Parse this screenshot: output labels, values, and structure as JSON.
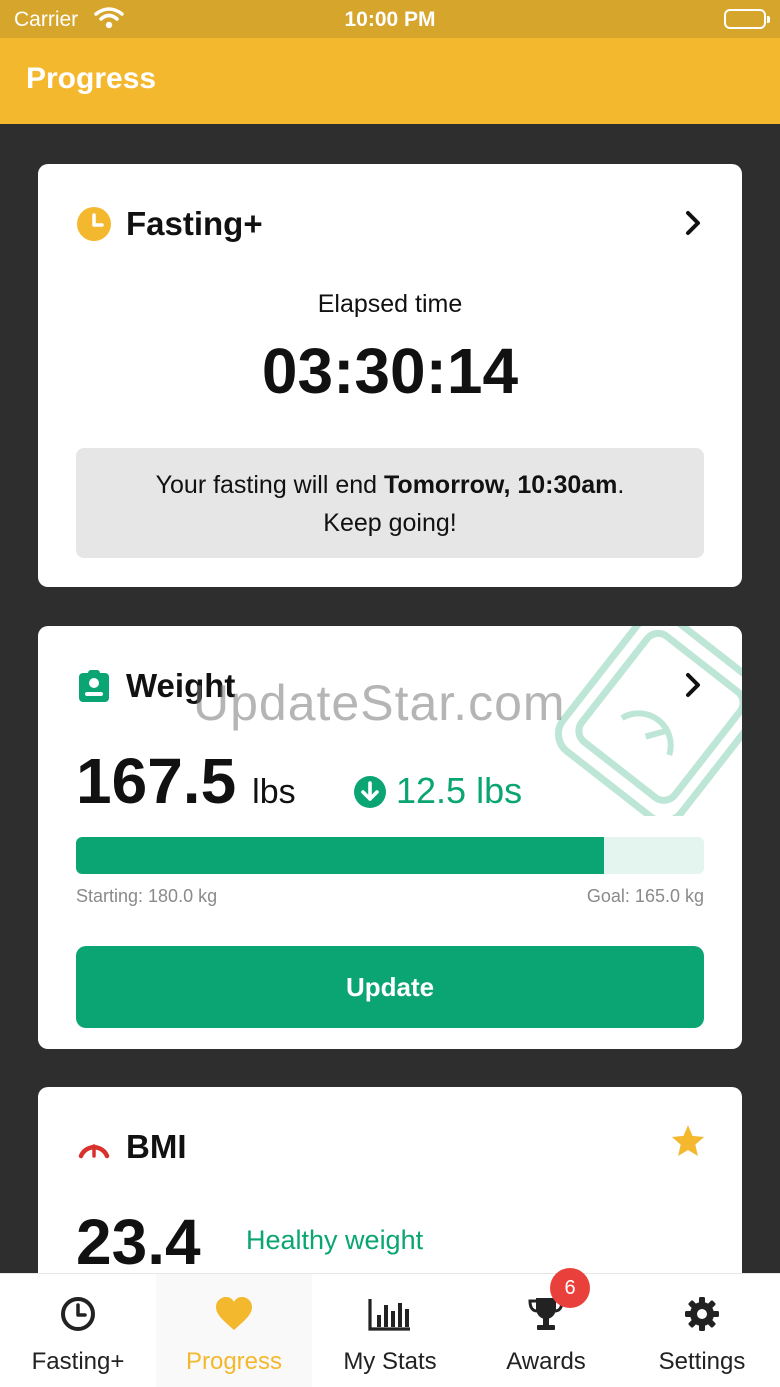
{
  "status_bar": {
    "carrier": "Carrier",
    "time": "10:00 PM"
  },
  "nav": {
    "title": "Progress"
  },
  "fasting_card": {
    "title": "Fasting+",
    "icon": "clock-icon",
    "elapsed_label": "Elapsed time",
    "elapsed_time": "03:30:14",
    "note_prefix": "Your fasting will end ",
    "note_end_time": "Tomorrow, 10:30am",
    "note_suffix": ".",
    "note_line2": "Keep going!"
  },
  "weight_card": {
    "title": "Weight",
    "icon": "scale-icon",
    "value": "167.5",
    "unit": "lbs",
    "change": "12.5 lbs",
    "change_direction": "down",
    "progress_fraction": 0.84,
    "starting_label": "Starting: 180.0 kg",
    "goal_label": "Goal: 165.0 kg",
    "update_label": "Update",
    "watermark": "UpdateStar.com"
  },
  "bmi_card": {
    "title": "BMI",
    "icon": "gauge-icon",
    "value": "23.4",
    "status": "Healthy weight"
  },
  "tabs": [
    {
      "label": "Fasting+",
      "icon": "clock-icon",
      "active": false
    },
    {
      "label": "Progress",
      "icon": "heart-icon",
      "active": true
    },
    {
      "label": "My Stats",
      "icon": "bar-chart-icon",
      "active": false
    },
    {
      "label": "Awards",
      "icon": "trophy-icon",
      "active": false,
      "badge": "6"
    },
    {
      "label": "Settings",
      "icon": "gear-icon",
      "active": false
    }
  ],
  "colors": {
    "accent": "#f4b82f",
    "header": "#d6a52c",
    "success": "#0aa572",
    "danger": "#e9403c",
    "background": "#2e2e2e"
  }
}
